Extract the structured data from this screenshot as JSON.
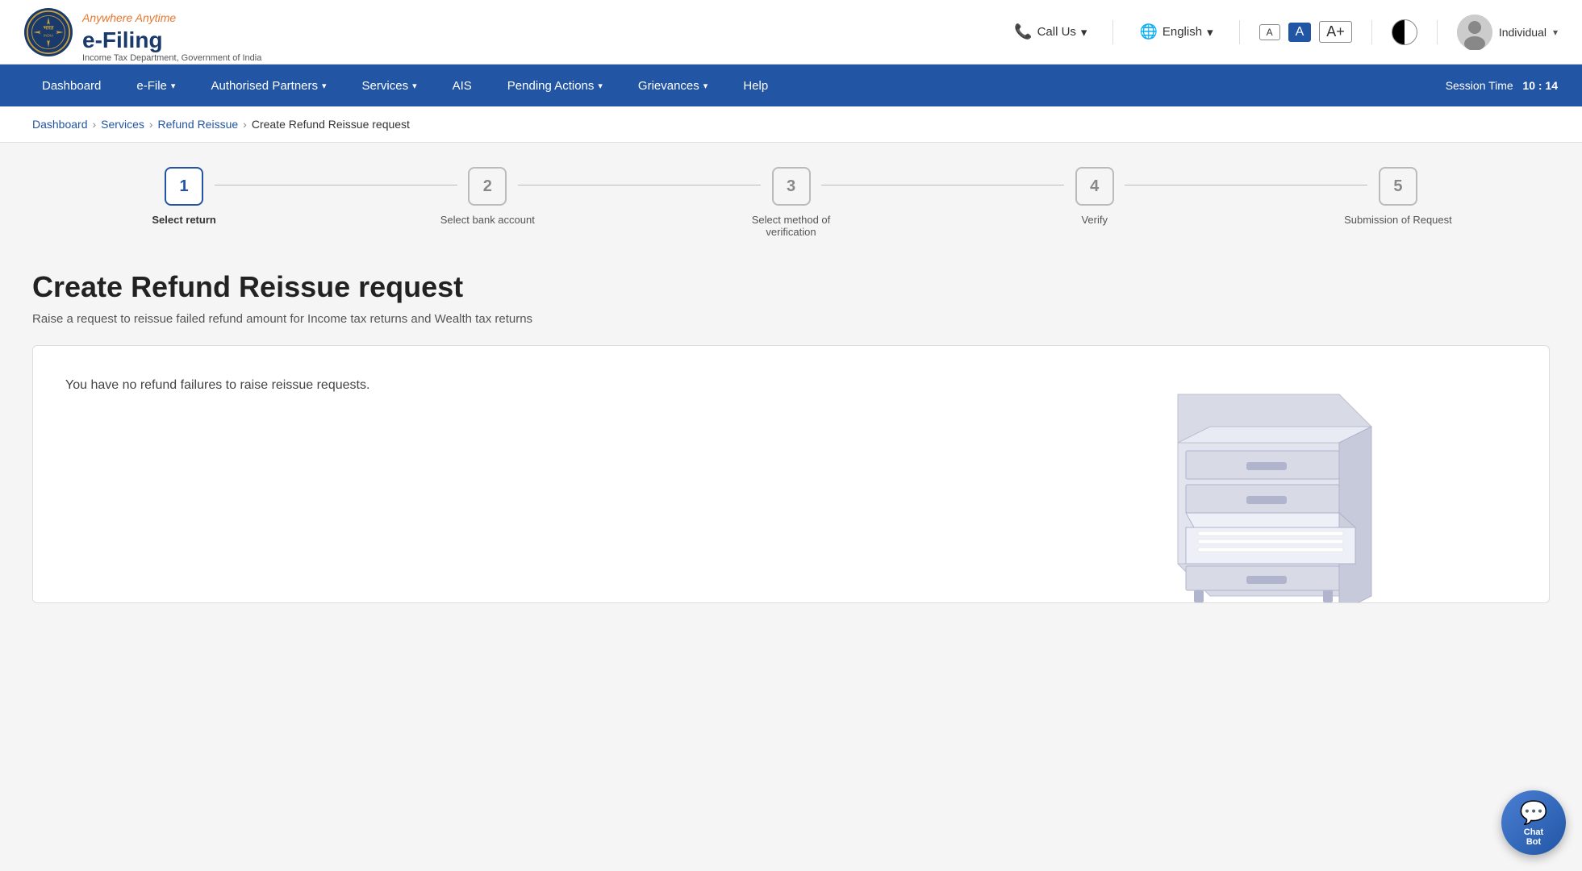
{
  "header": {
    "logo_efiling": "e-Filing",
    "logo_tagline": "Anywhere Anytime",
    "logo_sub": "Income Tax Department, Government of India",
    "call_us": "Call Us",
    "language": "English",
    "font_small": "A",
    "font_medium": "A",
    "font_large": "A+",
    "user_type": "Individual"
  },
  "nav": {
    "items": [
      {
        "label": "Dashboard",
        "has_arrow": false
      },
      {
        "label": "e-File",
        "has_arrow": true
      },
      {
        "label": "Authorised Partners",
        "has_arrow": true
      },
      {
        "label": "Services",
        "has_arrow": true
      },
      {
        "label": "AIS",
        "has_arrow": false
      },
      {
        "label": "Pending Actions",
        "has_arrow": true
      },
      {
        "label": "Grievances",
        "has_arrow": true
      },
      {
        "label": "Help",
        "has_arrow": false
      }
    ],
    "session_label": "Session Time",
    "session_value": "10 : 14"
  },
  "breadcrumb": {
    "items": [
      {
        "label": "Dashboard",
        "link": true
      },
      {
        "label": "Services",
        "link": true
      },
      {
        "label": "Refund Reissue",
        "link": true
      },
      {
        "label": "Create Refund Reissue request",
        "link": false
      }
    ]
  },
  "steps": [
    {
      "number": "1",
      "label": "Select return",
      "active": true
    },
    {
      "number": "2",
      "label": "Select bank account",
      "active": false
    },
    {
      "number": "3",
      "label": "Select method of verification",
      "active": false
    },
    {
      "number": "4",
      "label": "Verify",
      "active": false
    },
    {
      "number": "5",
      "label": "Submission of Request",
      "active": false
    }
  ],
  "page": {
    "title": "Create Refund Reissue request",
    "subtitle": "Raise a request to reissue failed refund amount for Income tax returns and Wealth tax returns",
    "no_data_text": "You have no refund failures to raise reissue requests."
  },
  "chatbot": {
    "label": "Chat\nBot"
  }
}
